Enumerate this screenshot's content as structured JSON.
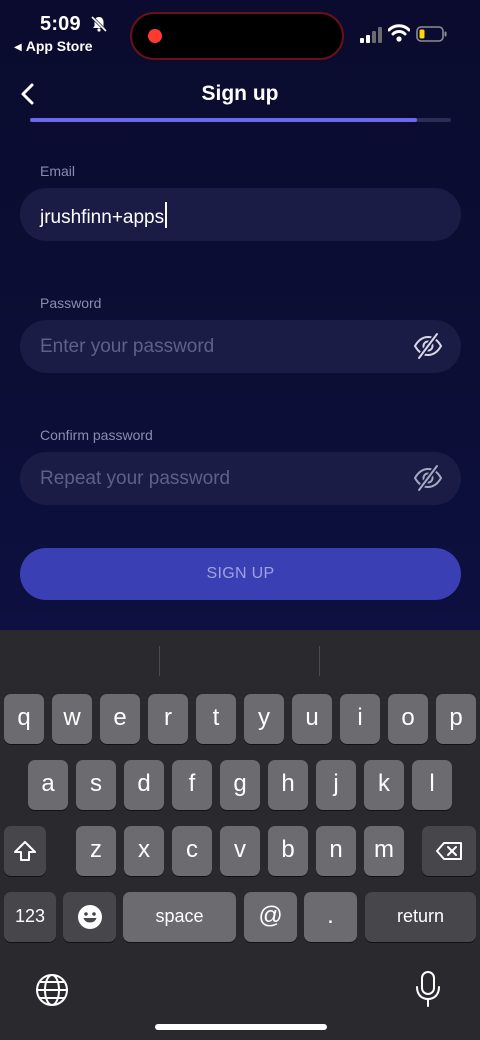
{
  "status_bar": {
    "time": "5:09",
    "back_app": "App Store"
  },
  "header": {
    "title": "Sign up",
    "progress_fraction": 0.92
  },
  "form": {
    "email_label": "Email",
    "email_value": "jrushfinn+apps",
    "password_label": "Password",
    "password_placeholder": "Enter your password",
    "confirm_label": "Confirm password",
    "confirm_placeholder": "Repeat your password",
    "submit_label": "SIGN UP"
  },
  "keyboard": {
    "row1": [
      "q",
      "w",
      "e",
      "r",
      "t",
      "y",
      "u",
      "i",
      "o",
      "p"
    ],
    "row2": [
      "a",
      "s",
      "d",
      "f",
      "g",
      "h",
      "j",
      "k",
      "l"
    ],
    "row3": [
      "z",
      "x",
      "c",
      "v",
      "b",
      "n",
      "m"
    ],
    "numbers_key": "123",
    "space_key": "space",
    "at_key": "@",
    "dot_key": ".",
    "return_key": "return"
  },
  "colors": {
    "accent": "#6a6af0",
    "button": "#3a3fb3",
    "background": "#0b0c30"
  }
}
